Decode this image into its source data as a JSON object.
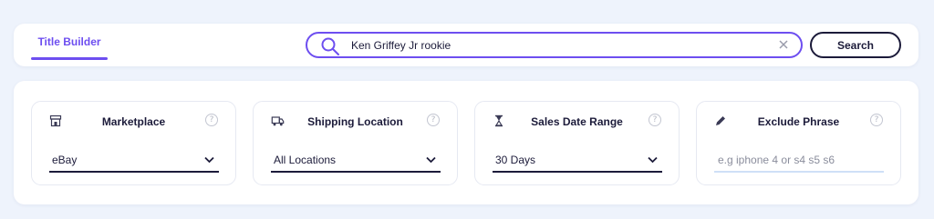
{
  "header": {
    "tab_label": "Title Builder",
    "search": {
      "value": "Ken Griffey Jr rookie",
      "placeholder": ""
    },
    "search_button_label": "Search"
  },
  "filters": {
    "marketplace": {
      "title": "Marketplace",
      "icon": "store-icon",
      "value": "eBay"
    },
    "shipping": {
      "title": "Shipping Location",
      "icon": "truck-icon",
      "value": "All Locations"
    },
    "sales_date": {
      "title": "Sales Date Range",
      "icon": "hourglass-icon",
      "value": "30 Days"
    },
    "exclude": {
      "title": "Exclude Phrase",
      "icon": "pencil-icon",
      "placeholder": "e.g iphone 4 or s4 s5 s6"
    },
    "help_glyph": "?"
  },
  "colors": {
    "accent": "#6d4ef0",
    "text": "#1c1b3a",
    "background": "#eef3fc"
  }
}
